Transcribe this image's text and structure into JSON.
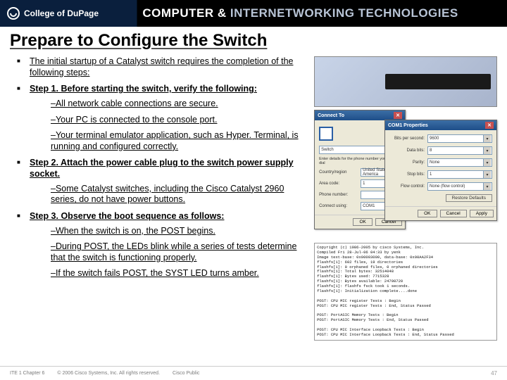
{
  "header": {
    "college": "College of DuPage",
    "title_a": "COMPUTER &",
    "title_b": "INTERNETWORKING TECHNOLOGIES"
  },
  "slide": {
    "title": "Prepare to Configure the Switch",
    "intro": "The initial startup of a Catalyst switch requires the completion of the following steps:",
    "step1_lead": "Step 1. Before starting the switch, verify the following:",
    "step1_items": [
      "–All network cable connections are secure.",
      "–Your PC is connected to the console port.",
      "–Your terminal emulator application, such as Hyper. Terminal, is running and configured correctly."
    ],
    "step2_lead": "Step 2. Attach the power cable plug to the switch power supply socket.",
    "step2_items": [
      "–Some Catalyst switches, including the Cisco Catalyst 2960 series, do not have power buttons."
    ],
    "step3_lead": "Step 3. Observe the boot sequence as follows:",
    "step3_items": [
      "–When the switch is on, the POST begins.",
      "–During POST, the LEDs blink while a series of tests determine that the switch is functioning properly.",
      "–If the switch fails POST, the SYST LED turns amber."
    ]
  },
  "dialog1": {
    "title": "Connect To",
    "name_val": "Switch",
    "desc": "Enter details for the phone number you want to dial",
    "country_label": "Country/region",
    "country_val": "United States of America",
    "area_label": "Area code:",
    "area_val": "1",
    "phone_label": "Phone number:",
    "connect_label": "Connect using:",
    "connect_val": "COM1",
    "ok": "OK",
    "cancel": "Cancel"
  },
  "dialog2": {
    "title": "COM1 Properties",
    "bps_label": "Bits per second:",
    "bps_val": "9600",
    "data_label": "Data bits:",
    "data_val": "8",
    "parity_label": "Parity:",
    "parity_val": "None",
    "stop_label": "Stop bits:",
    "stop_val": "1",
    "flow_label": "Flow control:",
    "flow_val": "None (flow control)",
    "restore": "Restore Defaults",
    "ok": "OK",
    "cancel": "Cancel",
    "apply": "Apply"
  },
  "terminal": "Copyright (c) 1986-2005 by cisco Systems, Inc.\nCompiled Fri 28-Jul-06 04:33 by yenk\nImage text-base: 0x00003000, data-base: 0x00AA2F34\nflashfs[1]: 602 files, 19 directories\nflashfs[1]: 0 orphaned files, 0 orphaned directories\nflashfs[1]: Total bytes: 32514048\nflashfs[1]: Bytes used: 7715328\nflashfs[1]: Bytes available: 24798720\nflashfs[1]: flashfs fsck took 1 seconds.\nflashfs[1]: Initialization complete....done\n\nPOST: CPU MIC register Tests : Begin\nPOST: CPU MIC register Tests : End, Status Passed\n\nPOST: PortASIC Memory Tests : Begin\nPOST: PortASIC Memory Tests : End, Status Passed\n\nPOST: CPU MIC Interface Loopback Tests : Begin\nPOST: CPU MIC Interface Loopback Tests : End, Status Passed",
  "footer": {
    "left1": "ITE 1 Chapter 6",
    "left2": "© 2006 Cisco Systems, Inc. All rights reserved.",
    "left3": "Cisco Public",
    "page": "47"
  }
}
